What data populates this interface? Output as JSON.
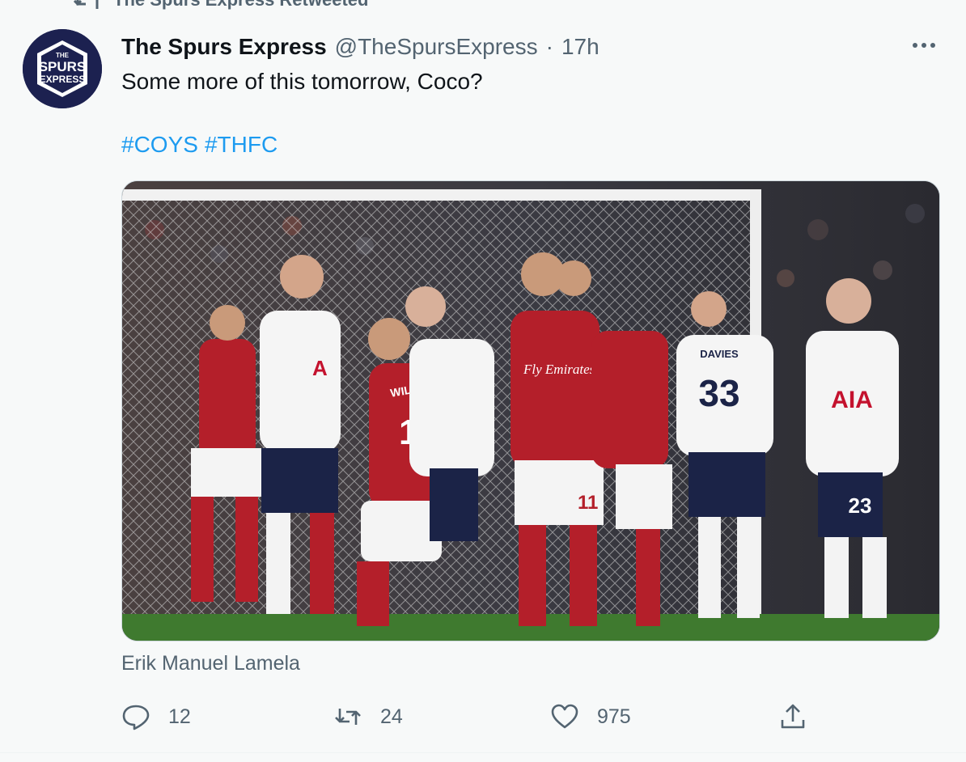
{
  "retweet": {
    "label": "The Spurs Express Retweeted"
  },
  "avatar": {
    "line1": "THE",
    "line2": "SPURS",
    "line3": "EXPRESS",
    "bg": "#1c2150"
  },
  "tweet": {
    "display_name": "The Spurs Express",
    "handle": "@TheSpursExpress",
    "separator": "·",
    "time": "17h",
    "text": "Some more of this tomorrow, Coco?",
    "hashtags": [
      "#COYS",
      "#THFC"
    ],
    "tagged_user": "Erik Manuel Lamela"
  },
  "actions": {
    "reply_count": "12",
    "retweet_count": "24",
    "like_count": "975"
  },
  "photo": {
    "shirt_text": "Fly Emirates",
    "sponsor": "AIA",
    "names": [
      "WILSHERE",
      "DAVIES"
    ],
    "numbers": [
      "10",
      "33",
      "23",
      "11"
    ]
  },
  "colors": {
    "accent": "#1d9bf0",
    "secondary_text": "#536471",
    "primary_text": "#0f1419",
    "background": "#f7f9f9"
  }
}
